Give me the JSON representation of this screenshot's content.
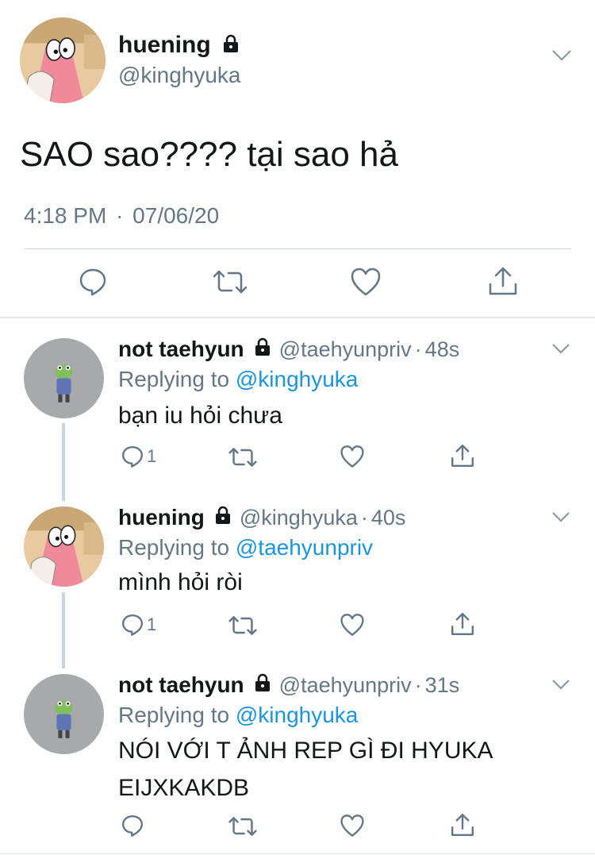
{
  "main_tweet": {
    "name": "huening",
    "handle": "@kinghyuka",
    "text": "SAO sao???? tại sao hả",
    "time": "4:18 PM",
    "date": "07/06/20",
    "separator": "·"
  },
  "replies": [
    {
      "name": "not taehyun",
      "handle": "@taehyunpriv",
      "separator": "·",
      "age": "48s",
      "replying_prefix": "Replying to",
      "replying_to": "@kinghyuka",
      "text_lines": [
        "bạn iu hỏi chưa"
      ],
      "reply_count": "1"
    },
    {
      "name": "huening",
      "handle": "@kinghyuka",
      "separator": "·",
      "age": "40s",
      "replying_prefix": "Replying to",
      "replying_to": "@taehyunpriv",
      "text_lines": [
        "mình hỏi ròi"
      ],
      "reply_count": "1"
    },
    {
      "name": "not taehyun",
      "handle": "@taehyunpriv",
      "separator": "·",
      "age": "31s",
      "replying_prefix": "Replying to",
      "replying_to": "@kinghyuka",
      "text_lines": [
        "NÓI VỚI T ẢNH REP GÌ ĐI HYUKA",
        "EIJXKAKDB"
      ],
      "reply_count": ""
    }
  ],
  "icons": [
    "lock-icon",
    "chevron-down-icon",
    "reply-icon",
    "retweet-icon",
    "like-icon",
    "share-icon"
  ],
  "colors": {
    "text": "#14171a",
    "secondary": "#657786",
    "link": "#1b95e0",
    "divider": "#e1e8ed",
    "icon": "#657786"
  }
}
